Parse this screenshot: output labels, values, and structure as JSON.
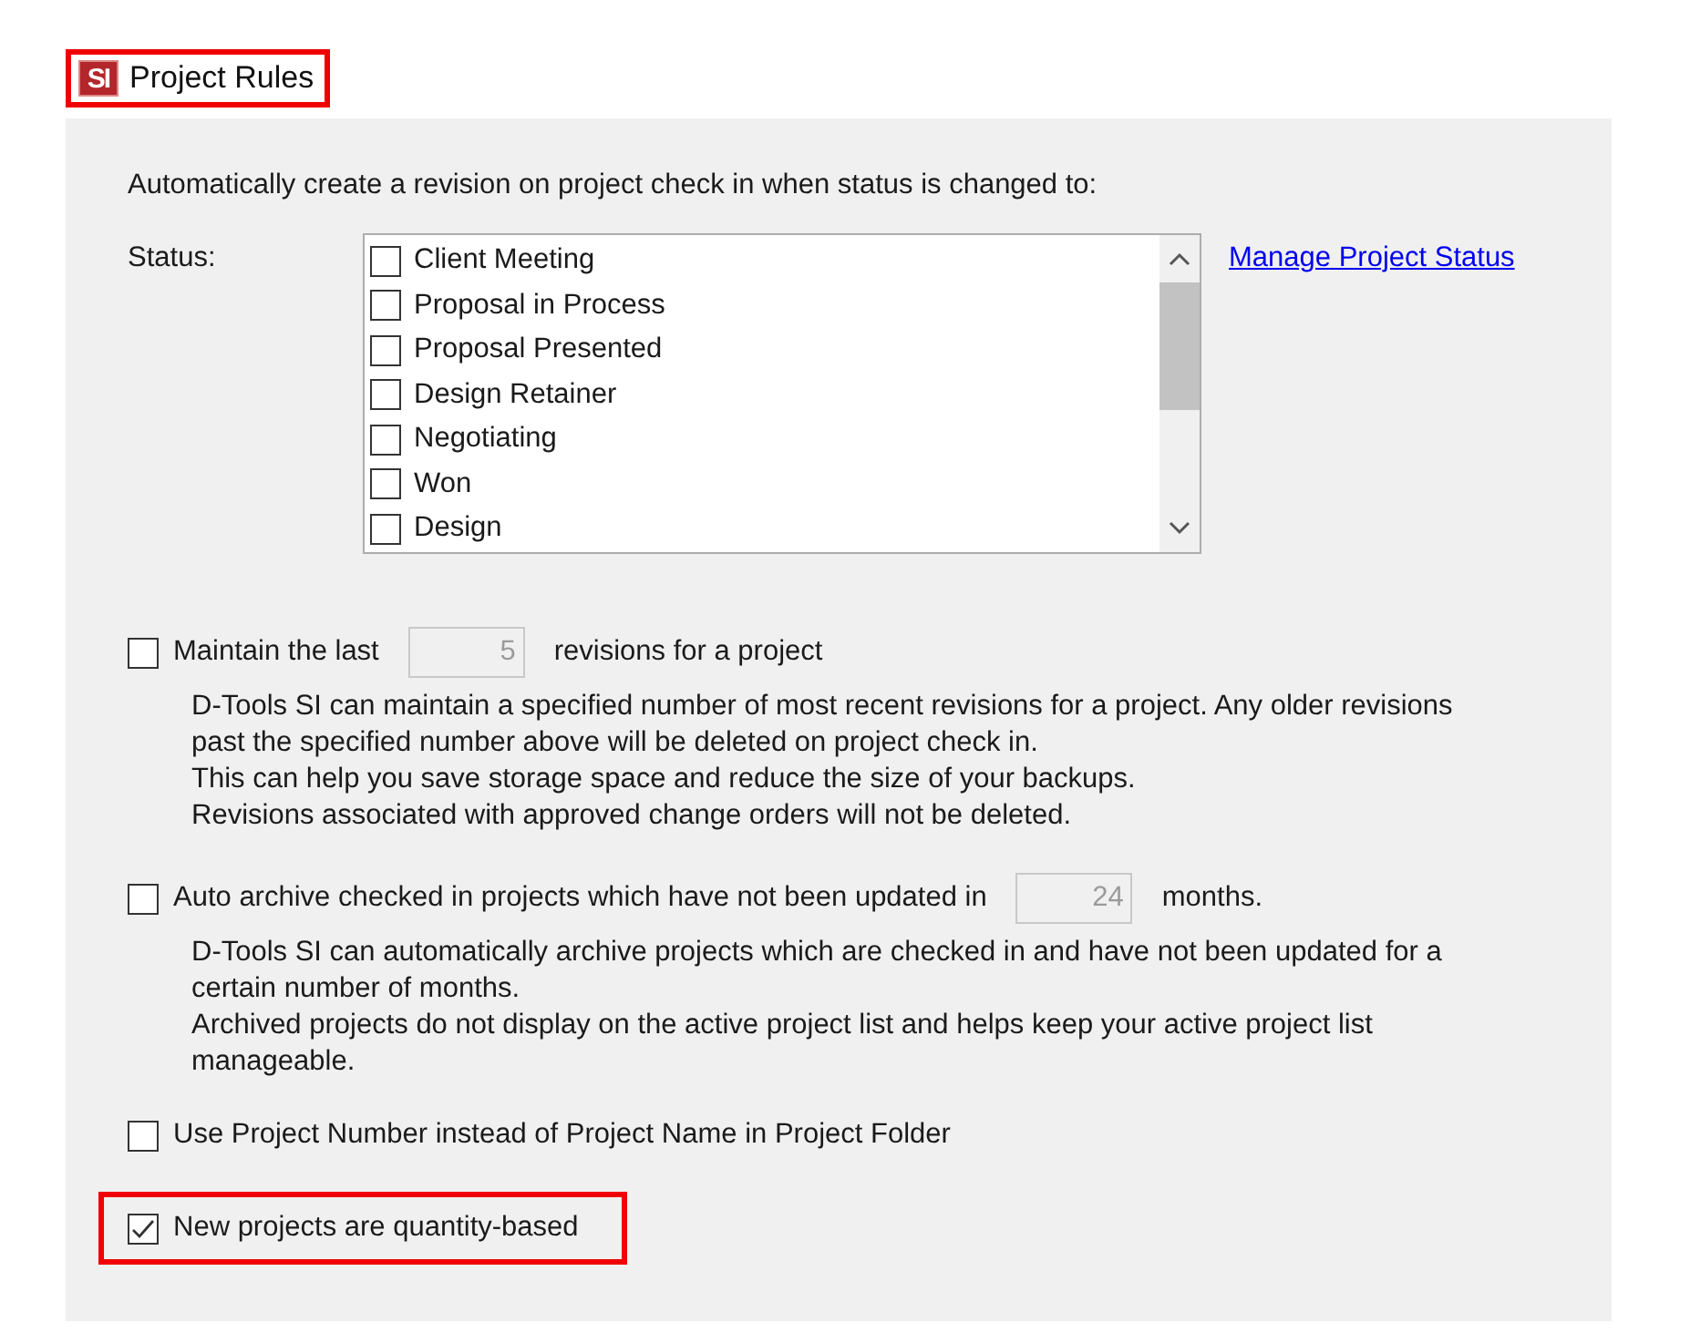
{
  "title": {
    "logo": "SI",
    "text": "Project Rules",
    "highlighted": true
  },
  "intro": "Automatically create a revision on project check in when status is changed to:",
  "status": {
    "label": "Status:",
    "link": "Manage Project Status",
    "items": [
      {
        "label": "Client Meeting",
        "checked": false
      },
      {
        "label": "Proposal in Process",
        "checked": false
      },
      {
        "label": "Proposal Presented",
        "checked": false
      },
      {
        "label": "Design Retainer",
        "checked": false
      },
      {
        "label": "Negotiating",
        "checked": false
      },
      {
        "label": "Won",
        "checked": false
      },
      {
        "label": "Design",
        "checked": false
      }
    ]
  },
  "options": [
    {
      "label_before": "Maintain the last",
      "value": "5",
      "label_after": "revisions for a project",
      "checked": false,
      "highlighted": false,
      "description_lines": [
        "D-Tools SI can maintain a specified number of most recent revisions for a project. Any older revisions",
        "past the specified number above will be deleted on project check in.",
        "This can help you save storage space and reduce the size of your backups.",
        "Revisions associated with approved change orders will not be deleted."
      ]
    },
    {
      "label_before": "Auto archive checked in projects which have not been updated in",
      "value": "24",
      "label_after": "months.",
      "checked": false,
      "highlighted": false,
      "description_lines": [
        "D-Tools SI can automatically archive projects which are checked in and have not been updated for a",
        "certain number of months.",
        "Archived projects do not display on the active project list and helps keep your active project list",
        "manageable."
      ]
    },
    {
      "label_before": "Use Project Number instead of Project Name in Project Folder",
      "checked": false,
      "highlighted": false
    },
    {
      "label_before": "New projects are quantity-based",
      "checked": true,
      "highlighted": true
    }
  ]
}
